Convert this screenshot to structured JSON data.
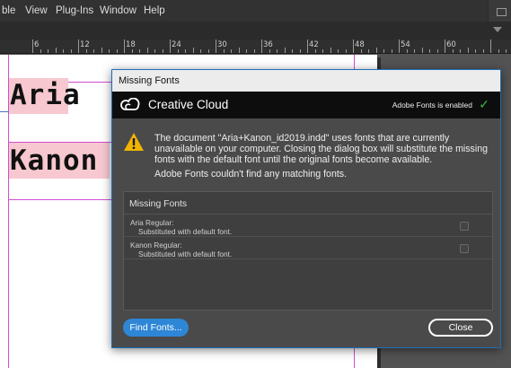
{
  "menubar": {
    "items": [
      "ble",
      "View",
      "Plug-Ins",
      "Window",
      "Help"
    ]
  },
  "ruler": {
    "labels": [
      "6",
      "12",
      "18",
      "24",
      "30",
      "36",
      "42",
      "48",
      "54",
      "60"
    ]
  },
  "document": {
    "frames": [
      {
        "text": "Aria"
      },
      {
        "text": "Kanon"
      }
    ]
  },
  "dialog": {
    "title": "Missing Fonts",
    "brand": "Creative Cloud",
    "adobe_fonts_status": "Adobe Fonts is enabled",
    "check_icon": "check-icon",
    "warning_icon": "warning-icon",
    "message": "The document \"Aria+Kanon_id2019.indd\" uses fonts that are currently unavailable on your computer. Closing the dialog box will substitute the missing fonts with the default font until the original fonts become available.",
    "message2": "Adobe Fonts couldn't find any matching fonts.",
    "list_header": "Missing Fonts",
    "fonts": [
      {
        "name": "Aria Regular:",
        "status": "Substituted with default font."
      },
      {
        "name": "Kanon Regular:",
        "status": "Substituted with default font."
      }
    ],
    "find_button": "Find Fonts...",
    "close_button": "Close"
  },
  "colors": {
    "accent": "#2e86d6",
    "check": "#3fbf3f",
    "warning": "#f0b400",
    "frame_fill": "#f7c8cf",
    "margin_guide": "#d14cd1"
  }
}
